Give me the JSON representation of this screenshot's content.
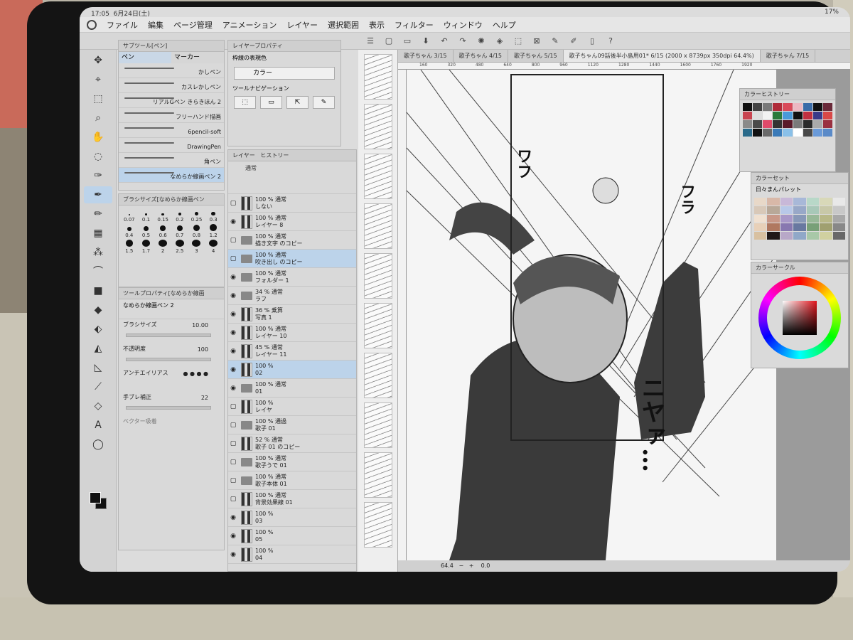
{
  "status": {
    "time": "17:05",
    "date": "6月24日(土)",
    "battery": "17%"
  },
  "menu": [
    "ファイル",
    "編集",
    "ページ管理",
    "アニメーション",
    "レイヤー",
    "選択範囲",
    "表示",
    "フィルター",
    "ウィンドウ",
    "ヘルプ"
  ],
  "subtool": {
    "title": "サブツール[ペン]",
    "tabs": [
      "ペン",
      "マーカー"
    ],
    "brushes": [
      "かしペン",
      "カスレかしペン",
      "リアルGペン きらきほん 2",
      "フリーハンド描画",
      "6pencil-soft",
      "DrawingPen",
      "角ペン",
      "なめらか線画ペン 2"
    ]
  },
  "brush_size": {
    "title": "ブラシサイズ[なめらか線画ペン",
    "sizes": [
      "0.07",
      "0.1",
      "0.15",
      "0.2",
      "0.25",
      "0.3",
      "0.4",
      "0.5",
      "0.6",
      "0.7",
      "0.8",
      "1.2",
      "1.5",
      "1.7",
      "2",
      "2.5",
      "3",
      "4"
    ]
  },
  "tool_property": {
    "title": "ツールプロパティ[なめらか線画",
    "brush_name": "なめらか線画ペン 2",
    "rows": [
      {
        "label": "ブラシサイズ",
        "value": "10.00"
      },
      {
        "label": "不透明度",
        "value": "100"
      },
      {
        "label": "アンチエイリアス",
        "value": ""
      },
      {
        "label": "手ブレ補正",
        "value": "22"
      },
      {
        "label": "ベクター吸着",
        "value": ""
      }
    ]
  },
  "layer_property": {
    "title": "レイヤープロパティ",
    "section1": "枠線の表現色",
    "color_button": "カラー",
    "section2": "ツールナビゲーション"
  },
  "layers": {
    "title": "レイヤー",
    "history_tab": "ヒストリー",
    "blend_mode": "通常",
    "rows": [
      {
        "opacity": "100 % 通常",
        "name": "しない",
        "kind": "text",
        "visible": false,
        "selected": false
      },
      {
        "opacity": "100 % 通常",
        "name": "レイヤー 8",
        "kind": "raster",
        "visible": true,
        "selected": false
      },
      {
        "opacity": "100 % 通常",
        "name": "描き文字 のコピー",
        "kind": "folder",
        "visible": false,
        "selected": false
      },
      {
        "opacity": "100 % 通常",
        "name": "吹き出し のコピー",
        "kind": "folder",
        "visible": false,
        "selected": true
      },
      {
        "opacity": "100 % 通常",
        "name": "フォルダー 1",
        "kind": "folder",
        "visible": true,
        "selected": false
      },
      {
        "opacity": "34 % 通常",
        "name": "ラフ",
        "kind": "folder",
        "visible": true,
        "selected": false
      },
      {
        "opacity": "36 % 乗算",
        "name": "写真 1",
        "kind": "raster",
        "visible": true,
        "selected": false
      },
      {
        "opacity": "100 % 通常",
        "name": "レイヤー 10",
        "kind": "raster",
        "visible": true,
        "selected": false
      },
      {
        "opacity": "45 % 通常",
        "name": "レイヤー 11",
        "kind": "raster",
        "visible": true,
        "selected": false
      },
      {
        "opacity": "100 %",
        "name": "02",
        "kind": "frame",
        "visible": true,
        "selected": true
      },
      {
        "opacity": "100 % 通常",
        "name": "01",
        "kind": "folder",
        "visible": true,
        "selected": false
      },
      {
        "opacity": "100 %",
        "name": "レイヤ",
        "kind": "raster",
        "visible": false,
        "selected": false
      },
      {
        "opacity": "100 % 通過",
        "name": "歌子 01",
        "kind": "folder",
        "visible": false,
        "selected": false
      },
      {
        "opacity": "52 % 通常",
        "name": "歌子 01 のコピー",
        "kind": "raster",
        "visible": false,
        "selected": false
      },
      {
        "opacity": "100 % 通常",
        "name": "歌子うで 01",
        "kind": "folder",
        "visible": false,
        "selected": false
      },
      {
        "opacity": "100 % 通常",
        "name": "歌子本体 01",
        "kind": "folder",
        "visible": false,
        "selected": false
      },
      {
        "opacity": "100 % 通常",
        "name": "背景効果線 01",
        "kind": "raster",
        "visible": false,
        "selected": false
      },
      {
        "opacity": "100 %",
        "name": "03",
        "kind": "frame",
        "visible": true,
        "selected": false
      },
      {
        "opacity": "100 %",
        "name": "05",
        "kind": "frame",
        "visible": true,
        "selected": false
      },
      {
        "opacity": "100 %",
        "name": "04",
        "kind": "frame",
        "visible": true,
        "selected": false
      }
    ]
  },
  "doc_tabs": [
    "歌子ちゃん 3/15",
    "歌子ちゃん 4/15",
    "歌子ちゃん 5/15",
    "歌子ちゃん09話後半小島用01* 6/15 (2000 x 8739px 350dpi 64.4%)",
    "歌子ちゃん 7/15"
  ],
  "ruler_top": [
    "160",
    "320",
    "480",
    "640",
    "800",
    "960",
    "1120",
    "1280",
    "1440",
    "1600",
    "1760",
    "1920"
  ],
  "canvas": {
    "sfx": [
      "ワフ",
      "フラ",
      "ニヤァ…"
    ],
    "zoom": "64.4",
    "rotation": "0.0"
  },
  "color_history": {
    "title": "カラーヒストリー"
  },
  "color_set": {
    "title": "カラーセット",
    "palette": "日々まんパレット"
  },
  "color_circle": {
    "title": "カラーサークル"
  },
  "colors": {
    "accent_blue": "#bcd3ea",
    "history": [
      "#111111",
      "#444444",
      "#7a7a7a",
      "#b02c3a",
      "#d94a5a",
      "#ecb8c2",
      "#3a6ca8",
      "#111111",
      "#6a2a3a",
      "#c84450",
      "#dddddd",
      "#f2f2f2",
      "#2a7a3a",
      "#4a9ad8",
      "#111111",
      "#c23040",
      "#3a3a8a",
      "#d84848",
      "#8a8a8a",
      "#4a4a4a",
      "#e04a6a",
      "#333333",
      "#5a1a2a",
      "#7a7a7a",
      "#2a2a2a",
      "#aaaaaa",
      "#9a3040",
      "#2a6a8a",
      "#111111",
      "#6a6a6a",
      "#3a7ab8",
      "#8ac0e8",
      "#ffffff",
      "#4a4a4a",
      "#6a9ad8",
      "#5a8ac8"
    ],
    "palette": [
      "#e8d8c8",
      "#d8b8a8",
      "#c8b8d8",
      "#a8b8d8",
      "#b8d8c8",
      "#d8d8b8",
      "#e8e8e8",
      "#d8c8b8",
      "#b8a898",
      "#b8c8e8",
      "#98a8c8",
      "#a8c8b8",
      "#c8c8a8",
      "#c8c8c8",
      "#f0e0d0",
      "#c89888",
      "#a898c8",
      "#8898b8",
      "#98b898",
      "#b8b888",
      "#a8a8a8",
      "#e8d0b8",
      "#b07860",
      "#8878b0",
      "#6878a0",
      "#78a078",
      "#a0a070",
      "#888888",
      "#d8c0a0",
      "#201818",
      "#b8a8c8",
      "#90a8c8",
      "#a8c8a8",
      "#d0d0a0",
      "#686868"
    ]
  }
}
